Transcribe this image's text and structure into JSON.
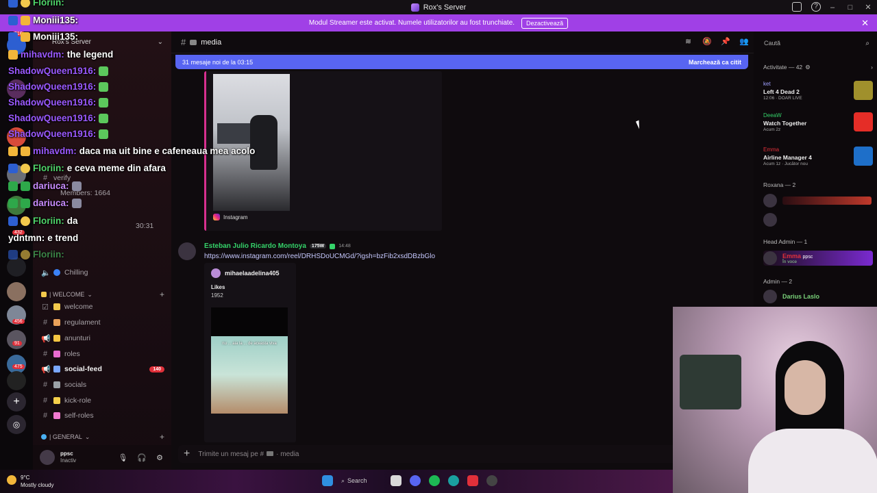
{
  "window": {
    "title": "Rox's Server"
  },
  "banner": {
    "text": "Modul Streamer este activat. Numele utilizatorilor au fost trunchiate.",
    "button": "Dezactivează"
  },
  "server": {
    "name": "Rox's Server"
  },
  "rail": {
    "badges": [
      "316",
      "456",
      "91",
      "475",
      "432"
    ]
  },
  "sidebar": {
    "voice_status": "Chilling",
    "members_count": "Members: 1664",
    "verify": "verify",
    "timer": "30:31",
    "categories": [
      {
        "label": "| WELCOME"
      },
      {
        "label": "| GENERAL"
      }
    ],
    "channels": [
      {
        "label": "welcome",
        "emoji_color": "#f2c94c"
      },
      {
        "label": "regulament",
        "emoji_color": "#e9a15a"
      },
      {
        "label": "anunturi",
        "emoji_color": "#f4c542"
      },
      {
        "label": "roles",
        "emoji_color": "#e96bd0"
      },
      {
        "label": "social-feed",
        "emoji_color": "#7aa7ff",
        "active": true,
        "badge": "140"
      },
      {
        "label": "socials",
        "emoji_color": "#9aa0a6"
      },
      {
        "label": "kick-role",
        "emoji_color": "#f5d04a"
      },
      {
        "label": "self-roles",
        "emoji_color": "#f27ad0"
      }
    ]
  },
  "user": {
    "name": "ppsc",
    "status": "Inactiv"
  },
  "chat_overlay": {
    "messages": [
      {
        "user": "Floriin:",
        "text": "",
        "color": "green"
      },
      {
        "user": "Moniii135:",
        "text": "",
        "color": "white"
      },
      {
        "user": "Moniii135:",
        "text": "",
        "color": "white"
      },
      {
        "user": "mihavdm:",
        "text": "the legend",
        "color": "purple"
      },
      {
        "user": "ShadowQueen1916:",
        "text": "",
        "color": "purple"
      },
      {
        "user": "ShadowQueen1916:",
        "text": "",
        "color": "purple"
      },
      {
        "user": "ShadowQueen1916:",
        "text": "",
        "color": "purple"
      },
      {
        "user": "ShadowQueen1916:",
        "text": "",
        "color": "purple"
      },
      {
        "user": "ShadowQueen1916:",
        "text": "",
        "color": "purple"
      },
      {
        "user": "mihavdm:",
        "text": "daca ma uit bine e cafeneaua mea acolo",
        "color": "purple"
      },
      {
        "user": "Floriin:",
        "text": "e ceva meme din afara",
        "color": "green"
      },
      {
        "user": "dariuca:",
        "text": "",
        "color": "pink"
      },
      {
        "user": "dariuca:",
        "text": "",
        "color": "pink"
      },
      {
        "user": "Floriin:",
        "text": "da",
        "color": "green"
      },
      {
        "user": "ydntmn:",
        "text": "e trend",
        "color": "white"
      },
      {
        "user": "Floriin:",
        "text": "",
        "color": "green"
      }
    ]
  },
  "channel": {
    "name": "media",
    "new_messages": "31 mesaje noi de la 03:15",
    "mark_read": "Marchează ca citit"
  },
  "embed1": {
    "source": "Instagram"
  },
  "post": {
    "author": "Esteban Julio Ricardo Montoya",
    "tag": "175W",
    "time": "14:48",
    "link": "https://www.instagram.com/reel/DRHSDoUCMGd/?igsh=bzFib2xsdDBzbGlo"
  },
  "embed2": {
    "author": "mihaelaadelina405",
    "field_title": "Likes",
    "field_value": "1952",
    "caption": "nu ... aia la ... de aceasta viva"
  },
  "composer": {
    "placeholder": "Trimite un mesaj pe #",
    "channel": "media"
  },
  "members": {
    "search_placeholder": "Caută",
    "activity_header": "Activitate — 42",
    "activities": [
      {
        "who": "ket",
        "what": "Left 4 Dead 2",
        "sub": "12:06 · DOAR LIVE",
        "thumb_color": "#a0902c"
      },
      {
        "who": "DeeaW",
        "what": "Watch Together",
        "sub": "Acum 2z",
        "thumb_color": "#e52d27"
      },
      {
        "who": "Emma",
        "what": "Airline Manager 4",
        "sub": "Acum 1z · Jucător nou",
        "thumb_color": "#1e6fc9"
      }
    ],
    "roles": [
      {
        "label": "Roxana — 2"
      },
      {
        "label": "Head Admin — 1"
      },
      {
        "label": "Admin — 2"
      }
    ],
    "head_admin_member": {
      "name": "Emma",
      "tag": "ppsc",
      "status": "În voce"
    },
    "admin_member": {
      "name": "Darius Laslo"
    }
  },
  "taskbar": {
    "temperature": "9°C",
    "weather": "Mostly cloudy",
    "search": "Search"
  }
}
